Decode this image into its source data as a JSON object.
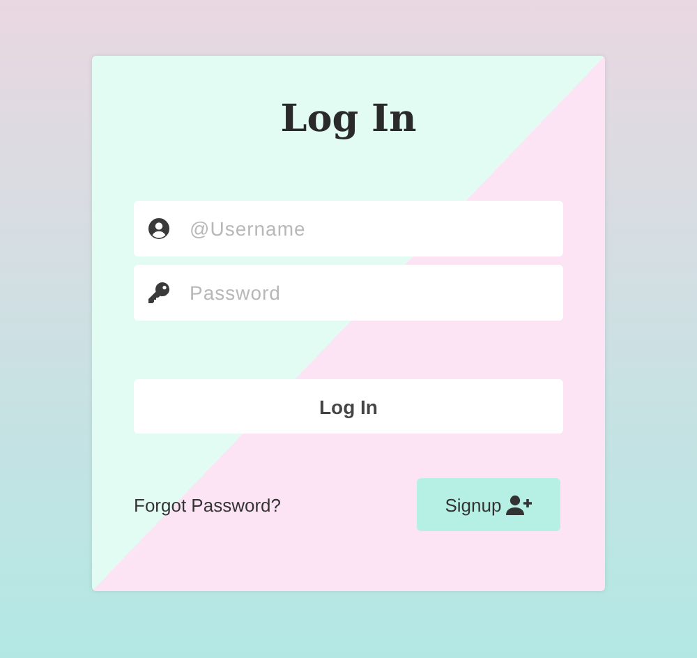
{
  "title": "Log In",
  "fields": [
    {
      "kind": "user",
      "placeholder": "@Username"
    },
    {
      "kind": "key",
      "placeholder": "Password"
    }
  ],
  "login_button": "Log In",
  "forgot_link": "Forgot Password?",
  "signup_button": "Signup"
}
